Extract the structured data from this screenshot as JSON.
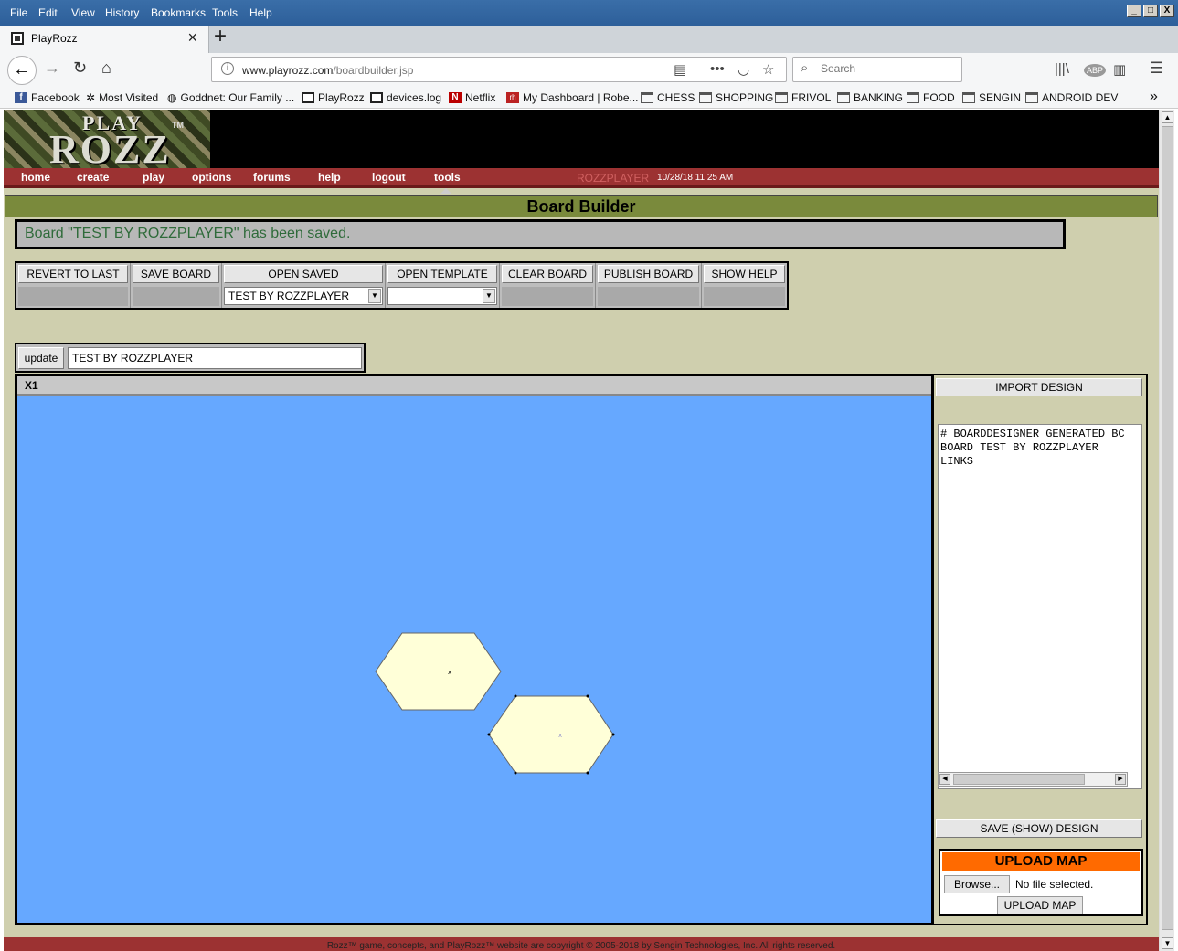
{
  "menu": {
    "items": [
      "File",
      "Edit",
      "View",
      "History",
      "Bookmarks",
      "Tools",
      "Help"
    ]
  },
  "window_controls": {
    "minimize": "_",
    "maximize": "□",
    "close": "X"
  },
  "tab": {
    "title": "PlayRozz",
    "close": "×",
    "new_tab": "+"
  },
  "nav": {
    "url_host": "www.playrozz.com",
    "url_path": "/boardbuilder.jsp",
    "search_placeholder": "Search",
    "icons": [
      "back-icon",
      "forward-icon",
      "reload-icon",
      "home-icon",
      "reader-icon",
      "more-icon",
      "pocket-icon",
      "star-icon",
      "library-icon",
      "adblock-icon",
      "sidebar-icon",
      "menu-icon"
    ]
  },
  "bookmarks": {
    "items": [
      {
        "label": "Facebook",
        "icon": "fb"
      },
      {
        "label": "Most Visited",
        "icon": "gear"
      },
      {
        "label": "Goddnet: Our Family ...",
        "icon": "globe"
      },
      {
        "label": "PlayRozz",
        "icon": "box"
      },
      {
        "label": "devices.log",
        "icon": "box"
      },
      {
        "label": "Netflix",
        "icon": "nf"
      },
      {
        "label": "My Dashboard | Robe...",
        "icon": "rh"
      },
      {
        "label": "CHESS",
        "icon": "folder"
      },
      {
        "label": "SHOPPING",
        "icon": "folder"
      },
      {
        "label": "FRIVOL",
        "icon": "folder"
      },
      {
        "label": "BANKING",
        "icon": "folder"
      },
      {
        "label": "FOOD",
        "icon": "folder"
      },
      {
        "label": "SENGIN",
        "icon": "folder"
      },
      {
        "label": "ANDROID DEV",
        "icon": "folder"
      }
    ],
    "overflow": "»"
  },
  "site": {
    "logo_top": "PLAY",
    "logo_main": "ROZZ",
    "logo_tm": "TM",
    "nav": [
      "home",
      "create",
      "play",
      "options",
      "forums",
      "help",
      "logout",
      "tools"
    ],
    "user": "ROZZPLAYER",
    "datetime": "10/28/18 11:25 AM",
    "page_title": "Board Builder",
    "message": "Board \"TEST BY ROZZPLAYER\" has been saved."
  },
  "toolbar": {
    "revert": "REVERT TO LAST",
    "save_board": "SAVE BOARD",
    "open_saved": "OPEN SAVED",
    "open_saved_value": "TEST BY ROZZPLAYER",
    "open_template": "OPEN TEMPLATE",
    "open_template_value": "",
    "clear_board": "CLEAR BOARD",
    "publish_board": "PUBLISH BOARD",
    "show_help": "SHOW HELP"
  },
  "namebar": {
    "update": "update",
    "name": "TEST BY ROZZPLAYER"
  },
  "board": {
    "header": "X1",
    "background": "#66a8ff",
    "hex_fill": "#ffffd8"
  },
  "side": {
    "import": "IMPORT DESIGN",
    "design_lines": [
      "# BOARDDESIGNER GENERATED BC",
      "BOARD TEST BY ROZZPLAYER",
      "LINKS"
    ],
    "save_show": "SAVE (SHOW) DESIGN",
    "upload_title": "UPLOAD MAP",
    "browse": "Browse...",
    "no_file": "No file selected.",
    "upload_btn": "UPLOAD MAP"
  },
  "footer": "Rozz™ game, concepts, and PlayRozz™ website are copyright © 2005-2018 by Sengin Technologies, Inc. All rights reserved."
}
